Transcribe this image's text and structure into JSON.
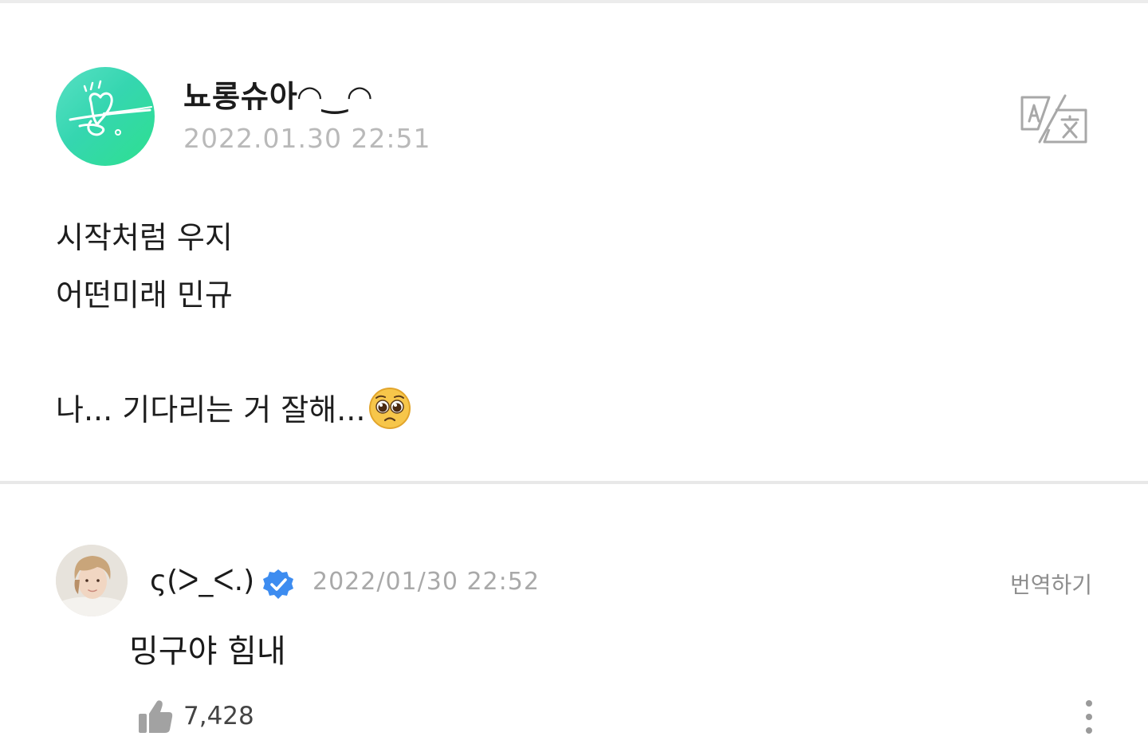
{
  "post": {
    "author": "뇨롱슈아◠‿◠",
    "timestamp": "2022.01.30 22:51",
    "translate_icon": "translate-icon",
    "body_lines": [
      "시작처럼 우지",
      "어떤미래 민규",
      "",
      "나... 기다리는 거 잘해..."
    ],
    "body_emoji": "pleading-face-emoji",
    "avatar_colors": {
      "from": "#58e0c4",
      "to": "#2ee08f"
    }
  },
  "comment": {
    "author": "ς(ᐳ_ᐸ.)",
    "verified_icon": "verified-badge-icon",
    "verified_color": "#3d8cf0",
    "timestamp": "2022/01/30 22:52",
    "translate_label": "번역하기",
    "text": "밍구야 힘내",
    "like_icon": "thumbs-up-icon",
    "like_count": "7,428",
    "more_icon": "more-vertical-icon"
  }
}
